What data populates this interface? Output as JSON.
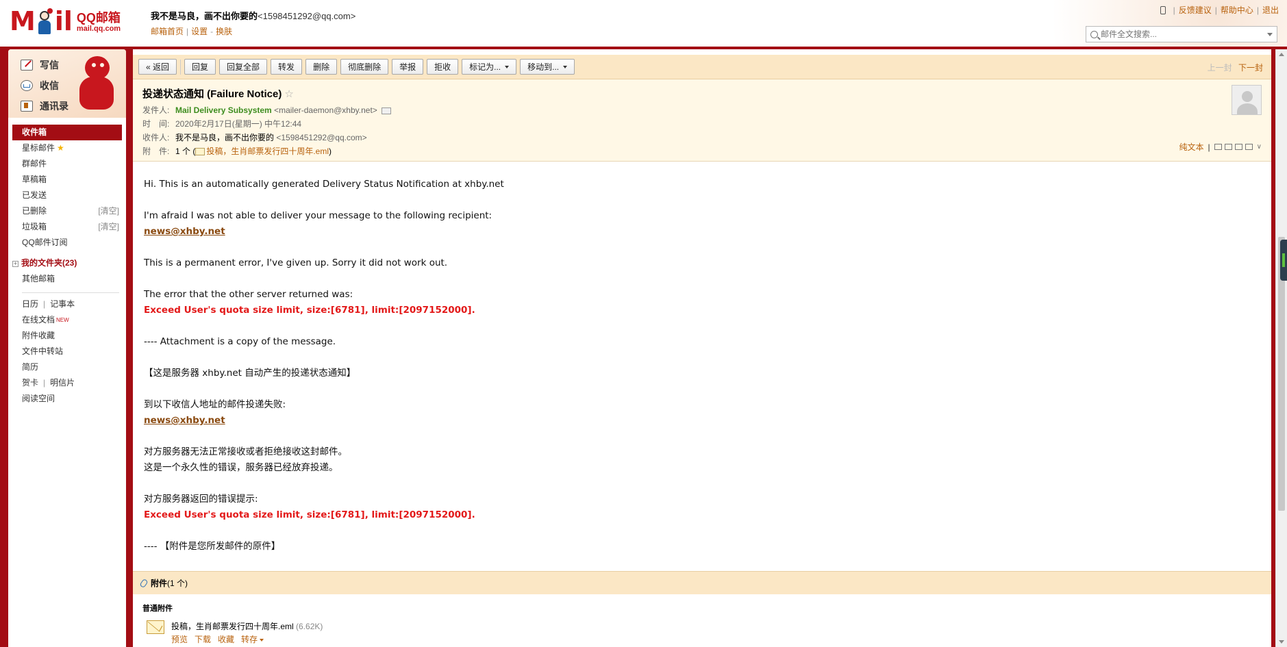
{
  "brand": {
    "logo_m": "M",
    "logo_il": "il",
    "name": "QQ邮箱",
    "url": "mail.qq.com"
  },
  "user": {
    "name": "我不是马良，画不出你要的",
    "email": "<1598451292@qq.com>",
    "links": [
      "邮箱首页",
      "设置",
      "换肤"
    ],
    "link_sep": "|",
    "link_dash": "-"
  },
  "top_links": {
    "feedback": "反馈建议",
    "help": "帮助中心",
    "logout": "退出",
    "sep": "|"
  },
  "search": {
    "placeholder": "邮件全文搜索..."
  },
  "sidebar": {
    "quick": [
      {
        "label": "写信",
        "icon": "write-icon"
      },
      {
        "label": "收信",
        "icon": "inbox-icon"
      },
      {
        "label": "通讯录",
        "icon": "contacts-icon"
      }
    ],
    "folders": {
      "inbox": "收件箱",
      "starred": "星标邮件",
      "group": "群邮件",
      "drafts": "草稿箱",
      "sent": "已发送",
      "deleted": "已删除",
      "spam": "垃圾箱",
      "clear": "[清空]",
      "subscribe": "QQ邮件订阅",
      "my_folders": "我的文件夹(23)",
      "other": "其他邮箱",
      "calendar": "日历",
      "notes": "记事本",
      "docs": "在线文档",
      "docs_badge": "NEW",
      "attach_fav": "附件收藏",
      "file_transfer": "文件中转站",
      "resume": "简历",
      "cards": "贺卡",
      "postcard": "明信片",
      "reading": "阅读空间",
      "sep": "|",
      "plus": "+",
      "star_glyph": "★"
    }
  },
  "toolbar": {
    "back": "« 返回",
    "reply": "回复",
    "reply_all": "回复全部",
    "forward": "转发",
    "delete": "删除",
    "perm_delete": "彻底删除",
    "report": "举报",
    "reject": "拒收",
    "mark_as": "标记为...",
    "move_to": "移动到...",
    "prev": "上一封",
    "next": "下一封"
  },
  "mail": {
    "subject": "投递状态通知 (Failure Notice)",
    "star": "☆",
    "from_label": "发件人:",
    "from_name": "Mail Delivery Subsystem",
    "from_addr": "<mailer-daemon@xhby.net>",
    "time_label": "时　间:",
    "time": "2020年2月17日(星期一) 中午12:44",
    "to_label": "收件人:",
    "to_name": "我不是马良，画不出你要的",
    "to_addr": "<1598451292@qq.com>",
    "attach_label": "附　件:",
    "attach_count": "1 个 (",
    "attach_name": "投稿，生肖邮票发行四十周年.eml",
    "attach_close": ")",
    "plain_text": "纯文本",
    "view_sep": "|",
    "view_chevron": "∨"
  },
  "body": {
    "l1": "Hi. This is an automatically generated Delivery Status Notification at xhby.net",
    "l2": "I'm afraid I was not able to deliver your message to the following recipient:",
    "recipient": "news@xhby.net",
    "l3": "This is a permanent error, I've given up. Sorry it did not work out.",
    "l4": "The error that the other server returned was:",
    "error": "Exceed User's quota size limit, size:[6781], limit:[2097152000].",
    "l5": "---- Attachment is a copy of the message.",
    "cn1": "【这是服务器 xhby.net 自动产生的投递状态通知】",
    "cn2": "到以下收信人地址的邮件投递失败:",
    "cn3": "对方服务器无法正常接收或者拒绝接收这封邮件。",
    "cn4": "这是一个永久性的错误，服务器已经放弃投递。",
    "cn5": "对方服务器返回的错误提示:",
    "cn6": "---- 【附件是您所发邮件的原件】"
  },
  "attachments": {
    "title": "附件",
    "count": "(1 个)",
    "section": "普通附件",
    "file_name": "投稿，生肖邮票发行四十周年.eml",
    "file_size": "(6.62K)",
    "actions": [
      "预览",
      "下载",
      "收藏",
      "转存"
    ]
  }
}
